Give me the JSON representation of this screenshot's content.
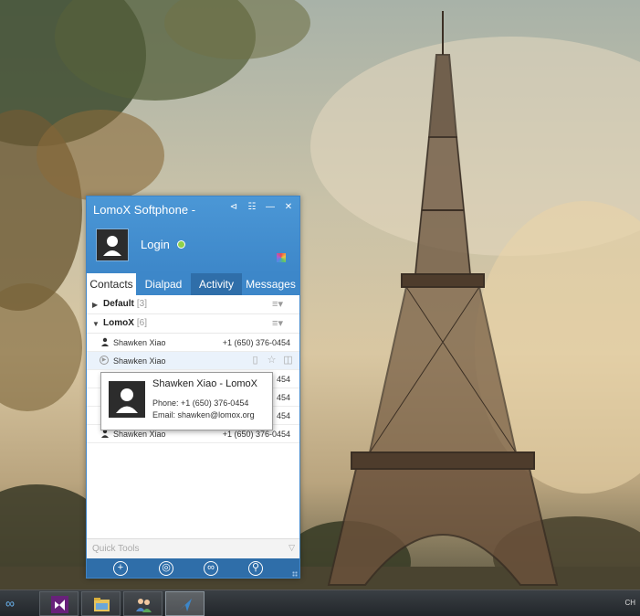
{
  "app": {
    "title": "LomoX Softphone -",
    "window_buttons": [
      "pin",
      "layout",
      "minimize",
      "close"
    ],
    "login_label": "Login",
    "status_color": "#8fd14a",
    "accent": "#3d87c9",
    "tabs": [
      {
        "label": "Contacts",
        "active": true
      },
      {
        "label": "Dialpad",
        "active": false
      },
      {
        "label": "Activity",
        "active": false
      },
      {
        "label": "Messages",
        "active": false
      }
    ],
    "groups": [
      {
        "name": "Default",
        "count": "[3]",
        "expanded": false
      },
      {
        "name": "LomoX",
        "count": "[6]",
        "expanded": true
      }
    ],
    "contacts": [
      {
        "name": "Shawken Xiao",
        "phone": "+1 (650) 376-0454"
      },
      {
        "name": "Shawken Xiao",
        "phone": ""
      },
      {
        "name": "",
        "phone": "454"
      },
      {
        "name": "",
        "phone": "454"
      },
      {
        "name": "",
        "phone": "454"
      },
      {
        "name": "Shawken Xiao",
        "phone": "+1 (650) 376-0454"
      }
    ],
    "card": {
      "title": "Shawken Xiao  - LomoX",
      "phone": "Phone: +1 (650) 376-0454",
      "email": "Email: shawken@lomox.org"
    },
    "quick_tools_label": "Quick Tools",
    "toolbar_icons": [
      "plus-icon",
      "target-icon",
      "link-icon",
      "search-icon"
    ]
  },
  "taskbar": {
    "language": "CH",
    "apps": [
      "visual-studio-icon",
      "file-explorer-icon",
      "contacts-icon",
      "lomox-icon"
    ]
  }
}
